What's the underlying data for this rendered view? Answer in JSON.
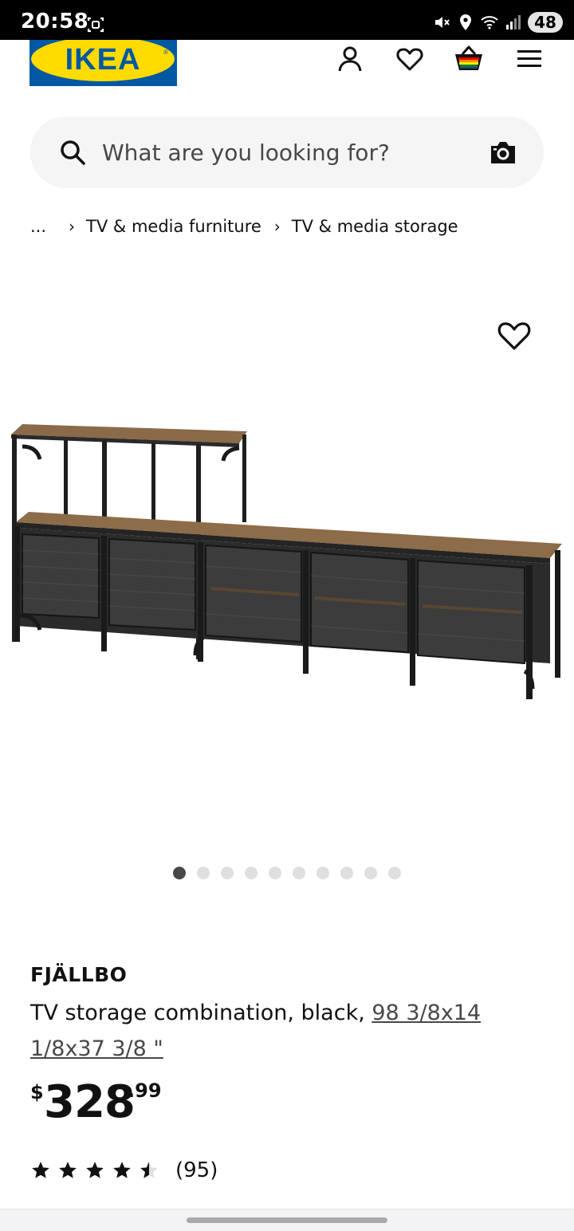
{
  "status_bar": {
    "time": "20:58",
    "battery": "48",
    "icons": [
      "screenshot-icon",
      "mute-icon",
      "location-icon",
      "wifi-icon",
      "signal-icon"
    ]
  },
  "header": {
    "logo_text": "IKEA",
    "logo_colors": {
      "blue": "#0058a3",
      "yellow": "#ffdb00"
    },
    "icons": [
      "profile-icon",
      "favourites-icon",
      "shopping-bag-icon",
      "menu-icon"
    ]
  },
  "search": {
    "placeholder": "What are you looking for?",
    "icons": [
      "search-icon",
      "camera-icon"
    ]
  },
  "breadcrumb": {
    "ellipsis": "...",
    "items": [
      "TV & media furniture",
      "TV & media storage"
    ]
  },
  "gallery": {
    "total_images": 10,
    "active_index": 0,
    "favourite_icon": "heart-icon"
  },
  "product": {
    "name": "FJÄLLBO",
    "description": "TV storage combination, black, ",
    "dimensions": "98 3/8x14 1/8x37 3/8 \"",
    "price": {
      "currency": "$",
      "integer": "328",
      "decimal": ".99"
    },
    "rating": 4.5,
    "rating_max": 5,
    "reviews": "(95)"
  },
  "colors": {
    "text": "#111111",
    "muted": "#484848",
    "search_bg": "#f5f5f5",
    "dot_active": "#484848",
    "dot_inactive": "#dfdfdf"
  }
}
